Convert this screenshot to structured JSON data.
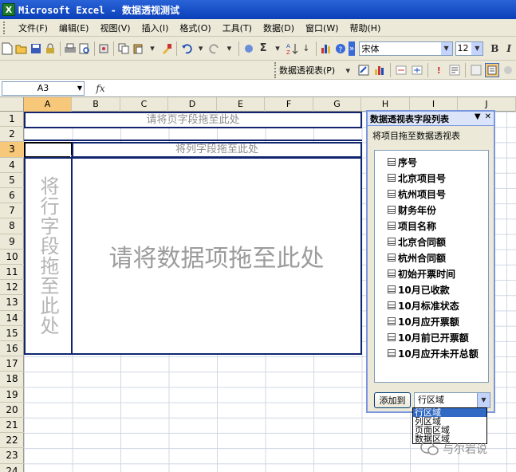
{
  "window": {
    "app_icon_letter": "X",
    "title": "Microsoft Excel - 数据透视测试"
  },
  "menu": [
    "文件(F)",
    "编辑(E)",
    "视图(V)",
    "插入(I)",
    "格式(O)",
    "工具(T)",
    "数据(D)",
    "窗口(W)",
    "帮助(H)"
  ],
  "toolbar": {
    "sigma": "Σ",
    "font_name": "宋体",
    "font_size": "12",
    "bold": "B",
    "italic": "I"
  },
  "pivot_toolbar": {
    "label": "数据透视表(P)"
  },
  "formula_bar": {
    "name_box": "A3",
    "fx": "fx",
    "formula": ""
  },
  "columns": [
    "A",
    "B",
    "C",
    "D",
    "E",
    "F",
    "G",
    "H",
    "I",
    "J"
  ],
  "rows": [
    "1",
    "2",
    "3",
    "4",
    "5",
    "6",
    "7",
    "8",
    "9",
    "10",
    "11",
    "12",
    "13",
    "14",
    "15",
    "16",
    "17",
    "18",
    "19",
    "20",
    "21",
    "22",
    "23",
    "24"
  ],
  "active": {
    "column": "A",
    "row": "3"
  },
  "drop_areas": {
    "page": "请将页字段拖至此处",
    "column": "将列字段拖至此处",
    "row": "将行字段拖至此处",
    "data": "请将数据项拖至此处"
  },
  "field_list": {
    "title": "数据透视表字段列表",
    "subtitle": "将项目拖至数据透视表",
    "fields": [
      "序号",
      "北京项目号",
      "杭州项目号",
      "财务年份",
      "项目名称",
      "北京合同额",
      "杭州合同额",
      "初始开票时间",
      "10月已收款",
      "10月标准状态",
      "10月应开票额",
      "10月前已开票额",
      "10月应开未开总额"
    ],
    "add_button": "添加到",
    "area_selected": "行区域",
    "area_options": [
      "行区域",
      "列区域",
      "页面区域",
      "数据区域"
    ]
  },
  "watermark": {
    "text": "与尔岩说"
  }
}
